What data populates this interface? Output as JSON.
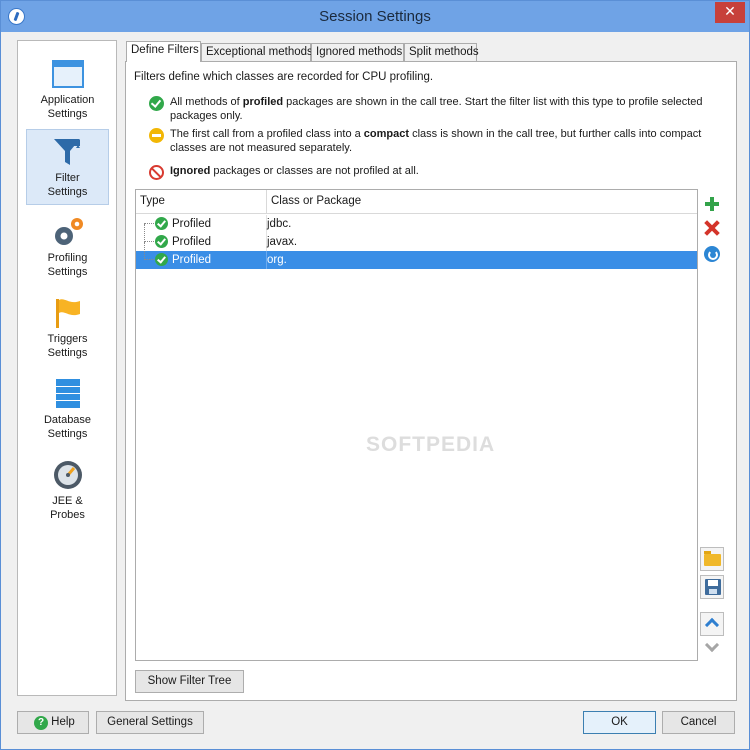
{
  "window": {
    "title": "Session Settings",
    "close_glyph": "✕"
  },
  "sidebar": {
    "items": [
      {
        "label": "Application\nSettings",
        "icon": "window-icon"
      },
      {
        "label": "Filter\nSettings",
        "icon": "funnel-icon",
        "active": true
      },
      {
        "label": "Profiling\nSettings",
        "icon": "gears-icon"
      },
      {
        "label": "Triggers\nSettings",
        "icon": "flag-icon"
      },
      {
        "label": "Database\nSettings",
        "icon": "database-icon"
      },
      {
        "label": "JEE &\nProbes",
        "icon": "gauge-icon"
      }
    ]
  },
  "tabs": [
    "Define Filters",
    "Exceptional methods",
    "Ignored methods",
    "Split methods"
  ],
  "intro": "Filters define which classes are recorded for CPU profiling.",
  "legend": {
    "profiled": {
      "pre": "All methods of ",
      "bold": "profiled",
      "post": " packages are shown in the call tree. Start the filter list with this type to profile selected packages only."
    },
    "compact": {
      "pre": "The first call from a profiled class into a ",
      "bold": "compact",
      "post": " class is shown in the call tree, but further calls into compact classes are not measured separately."
    },
    "ignored": {
      "pre": "",
      "bold": "Ignored",
      "post": " packages or classes are not profiled at all."
    }
  },
  "table": {
    "headers": {
      "type": "Type",
      "class": "Class or Package"
    },
    "rows": [
      {
        "type": "Profiled",
        "class": "jdbc."
      },
      {
        "type": "Profiled",
        "class": "javax."
      },
      {
        "type": "Profiled",
        "class": "org.",
        "selected": true
      }
    ]
  },
  "watermark": "SOFTPEDIA",
  "buttons": {
    "show_filter_tree": "Show Filter Tree",
    "help": "Help",
    "general_settings": "General Settings",
    "ok": "OK",
    "cancel": "Cancel"
  },
  "colors": {
    "accent": "#3a8ee6",
    "titlebar": "#6fa3e6",
    "profiled": "#31a84a",
    "compact": "#f2b705",
    "ignored": "#d83a30"
  }
}
